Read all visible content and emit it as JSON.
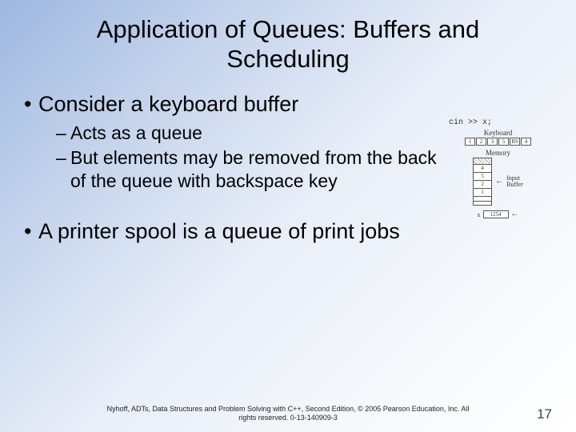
{
  "title": "Application of Queues: Buffers and Scheduling",
  "bullets": {
    "b1": "Consider a keyboard buffer",
    "b1_sub1": "Acts as a queue",
    "b1_sub2": "But elements may be removed from the back of the queue with backspace key",
    "b2": "A printer spool is a queue of print jobs"
  },
  "figure": {
    "code": "cin >> x;",
    "kb_label": "Keyboard",
    "kb_cells": [
      "1",
      "2",
      "3",
      "5",
      "BS",
      "4"
    ],
    "mem_label": "Memory",
    "mem_cells": [
      "4",
      "5",
      "2",
      "1"
    ],
    "buf_line1": "Input",
    "buf_line2": "Buffer",
    "x_label": "x",
    "x_value": "1254"
  },
  "footer": {
    "cite": "Nyhoff, ADTs, Data Structures and Problem Solving with C++, Second Edition, © 2005 Pearson Education, Inc. All rights reserved. 0-13-140909-3",
    "page": "17"
  }
}
